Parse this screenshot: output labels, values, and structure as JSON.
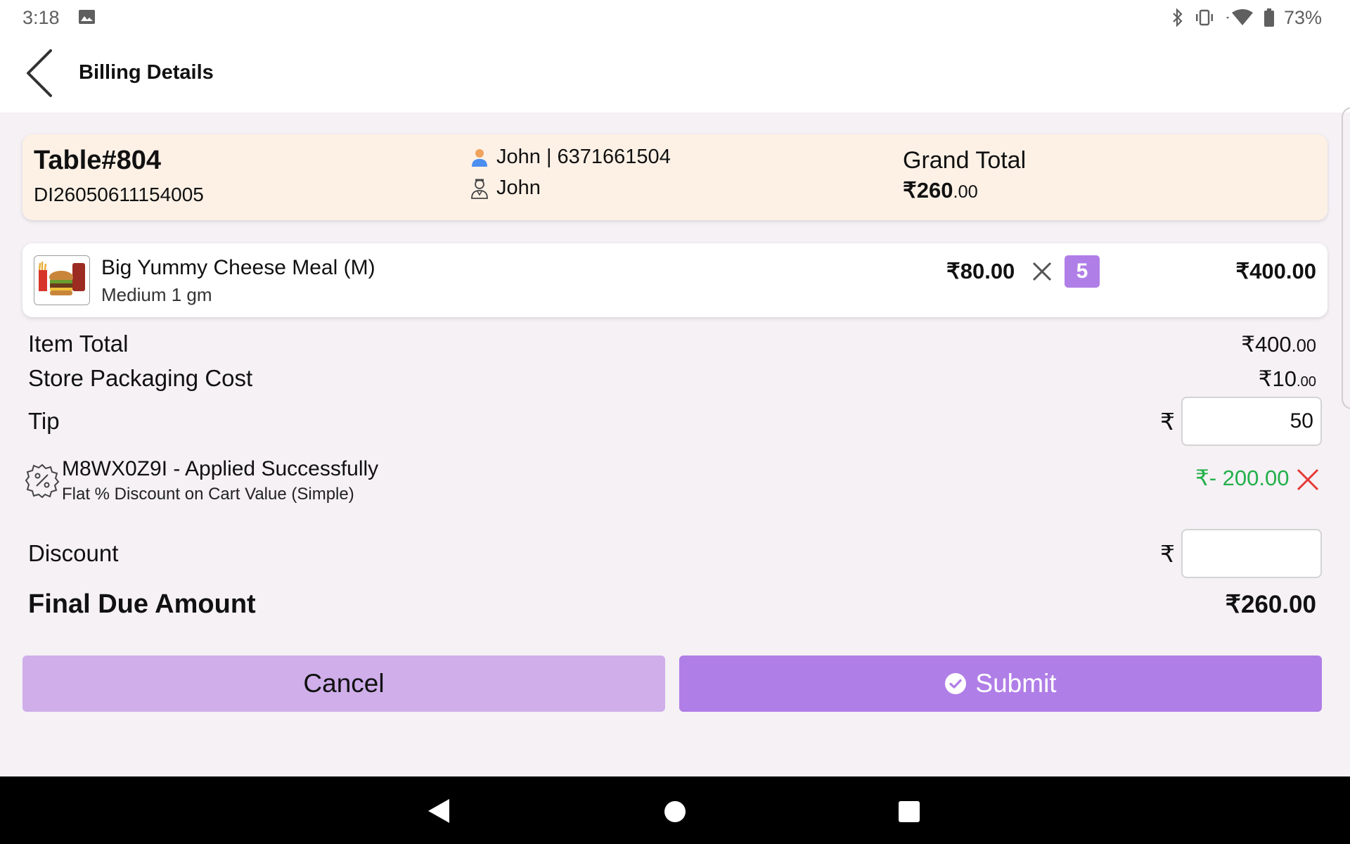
{
  "status_bar": {
    "time": "3:18",
    "battery": "73%"
  },
  "app_bar": {
    "title": "Billing Details"
  },
  "order": {
    "table": "Table#804",
    "order_id": "DI26050611154005",
    "customer": "John | 6371661504",
    "staff": "John",
    "grand_total_label": "Grand Total",
    "grand_total_main": "₹260",
    "grand_total_decimal": ".00"
  },
  "items": [
    {
      "name": "Big Yummy Cheese Meal (M)",
      "variant": "Medium 1 gm",
      "unit_price": "₹80.00",
      "quantity": "5",
      "line_total": "₹400.00"
    }
  ],
  "summary": {
    "item_total_label": "Item Total",
    "item_total_main": "₹400",
    "item_total_decimal": ".00",
    "packaging_label": "Store Packaging Cost",
    "packaging_main": "₹10",
    "packaging_decimal": ".00",
    "tip_label": "Tip",
    "currency_symbol": "₹",
    "tip_value": "50",
    "discount_label": "Discount",
    "discount_value": "",
    "final_label": "Final Due Amount",
    "final_amount": "₹260.00"
  },
  "coupon": {
    "code_status": "M8WX0Z9I - Applied Successfully",
    "description": "Flat % Discount on Cart Value (Simple)",
    "amount": "₹- 200.00",
    "amount_color": "#23b04a",
    "remove_color": "#e53935"
  },
  "actions": {
    "cancel_label": "Cancel",
    "submit_label": "Submit"
  },
  "colors": {
    "accent": "#b07ee7",
    "accent_light": "#cfaeea",
    "header_bg": "#fdf1e6"
  },
  "icons": [
    "image-icon",
    "bluetooth-icon",
    "vibrate-icon",
    "wifi-icon",
    "battery-icon",
    "back-arrow-icon",
    "customer-icon",
    "waiter-icon",
    "close-icon",
    "coupon-percent-icon",
    "check-circle-icon"
  ]
}
